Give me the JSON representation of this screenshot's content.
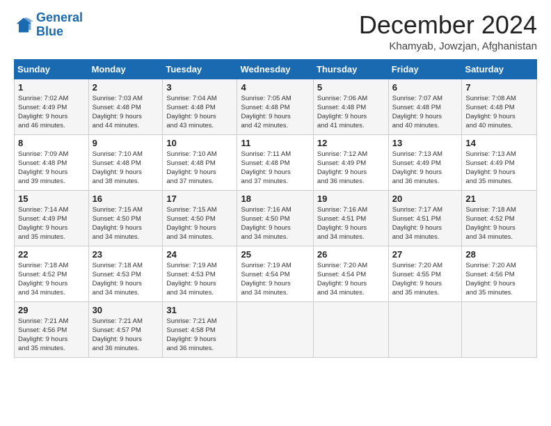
{
  "logo": {
    "line1": "General",
    "line2": "Blue"
  },
  "title": "December 2024",
  "subtitle": "Khamyab, Jowzjan, Afghanistan",
  "days_of_week": [
    "Sunday",
    "Monday",
    "Tuesday",
    "Wednesday",
    "Thursday",
    "Friday",
    "Saturday"
  ],
  "weeks": [
    [
      {
        "day": "1",
        "info": "Sunrise: 7:02 AM\nSunset: 4:49 PM\nDaylight: 9 hours\nand 46 minutes."
      },
      {
        "day": "2",
        "info": "Sunrise: 7:03 AM\nSunset: 4:48 PM\nDaylight: 9 hours\nand 44 minutes."
      },
      {
        "day": "3",
        "info": "Sunrise: 7:04 AM\nSunset: 4:48 PM\nDaylight: 9 hours\nand 43 minutes."
      },
      {
        "day": "4",
        "info": "Sunrise: 7:05 AM\nSunset: 4:48 PM\nDaylight: 9 hours\nand 42 minutes."
      },
      {
        "day": "5",
        "info": "Sunrise: 7:06 AM\nSunset: 4:48 PM\nDaylight: 9 hours\nand 41 minutes."
      },
      {
        "day": "6",
        "info": "Sunrise: 7:07 AM\nSunset: 4:48 PM\nDaylight: 9 hours\nand 40 minutes."
      },
      {
        "day": "7",
        "info": "Sunrise: 7:08 AM\nSunset: 4:48 PM\nDaylight: 9 hours\nand 40 minutes."
      }
    ],
    [
      {
        "day": "8",
        "info": "Sunrise: 7:09 AM\nSunset: 4:48 PM\nDaylight: 9 hours\nand 39 minutes."
      },
      {
        "day": "9",
        "info": "Sunrise: 7:10 AM\nSunset: 4:48 PM\nDaylight: 9 hours\nand 38 minutes."
      },
      {
        "day": "10",
        "info": "Sunrise: 7:10 AM\nSunset: 4:48 PM\nDaylight: 9 hours\nand 37 minutes."
      },
      {
        "day": "11",
        "info": "Sunrise: 7:11 AM\nSunset: 4:48 PM\nDaylight: 9 hours\nand 37 minutes."
      },
      {
        "day": "12",
        "info": "Sunrise: 7:12 AM\nSunset: 4:49 PM\nDaylight: 9 hours\nand 36 minutes."
      },
      {
        "day": "13",
        "info": "Sunrise: 7:13 AM\nSunset: 4:49 PM\nDaylight: 9 hours\nand 36 minutes."
      },
      {
        "day": "14",
        "info": "Sunrise: 7:13 AM\nSunset: 4:49 PM\nDaylight: 9 hours\nand 35 minutes."
      }
    ],
    [
      {
        "day": "15",
        "info": "Sunrise: 7:14 AM\nSunset: 4:49 PM\nDaylight: 9 hours\nand 35 minutes."
      },
      {
        "day": "16",
        "info": "Sunrise: 7:15 AM\nSunset: 4:50 PM\nDaylight: 9 hours\nand 34 minutes."
      },
      {
        "day": "17",
        "info": "Sunrise: 7:15 AM\nSunset: 4:50 PM\nDaylight: 9 hours\nand 34 minutes."
      },
      {
        "day": "18",
        "info": "Sunrise: 7:16 AM\nSunset: 4:50 PM\nDaylight: 9 hours\nand 34 minutes."
      },
      {
        "day": "19",
        "info": "Sunrise: 7:16 AM\nSunset: 4:51 PM\nDaylight: 9 hours\nand 34 minutes."
      },
      {
        "day": "20",
        "info": "Sunrise: 7:17 AM\nSunset: 4:51 PM\nDaylight: 9 hours\nand 34 minutes."
      },
      {
        "day": "21",
        "info": "Sunrise: 7:18 AM\nSunset: 4:52 PM\nDaylight: 9 hours\nand 34 minutes."
      }
    ],
    [
      {
        "day": "22",
        "info": "Sunrise: 7:18 AM\nSunset: 4:52 PM\nDaylight: 9 hours\nand 34 minutes."
      },
      {
        "day": "23",
        "info": "Sunrise: 7:18 AM\nSunset: 4:53 PM\nDaylight: 9 hours\nand 34 minutes."
      },
      {
        "day": "24",
        "info": "Sunrise: 7:19 AM\nSunset: 4:53 PM\nDaylight: 9 hours\nand 34 minutes."
      },
      {
        "day": "25",
        "info": "Sunrise: 7:19 AM\nSunset: 4:54 PM\nDaylight: 9 hours\nand 34 minutes."
      },
      {
        "day": "26",
        "info": "Sunrise: 7:20 AM\nSunset: 4:54 PM\nDaylight: 9 hours\nand 34 minutes."
      },
      {
        "day": "27",
        "info": "Sunrise: 7:20 AM\nSunset: 4:55 PM\nDaylight: 9 hours\nand 35 minutes."
      },
      {
        "day": "28",
        "info": "Sunrise: 7:20 AM\nSunset: 4:56 PM\nDaylight: 9 hours\nand 35 minutes."
      }
    ],
    [
      {
        "day": "29",
        "info": "Sunrise: 7:21 AM\nSunset: 4:56 PM\nDaylight: 9 hours\nand 35 minutes."
      },
      {
        "day": "30",
        "info": "Sunrise: 7:21 AM\nSunset: 4:57 PM\nDaylight: 9 hours\nand 36 minutes."
      },
      {
        "day": "31",
        "info": "Sunrise: 7:21 AM\nSunset: 4:58 PM\nDaylight: 9 hours\nand 36 minutes."
      },
      null,
      null,
      null,
      null
    ]
  ]
}
